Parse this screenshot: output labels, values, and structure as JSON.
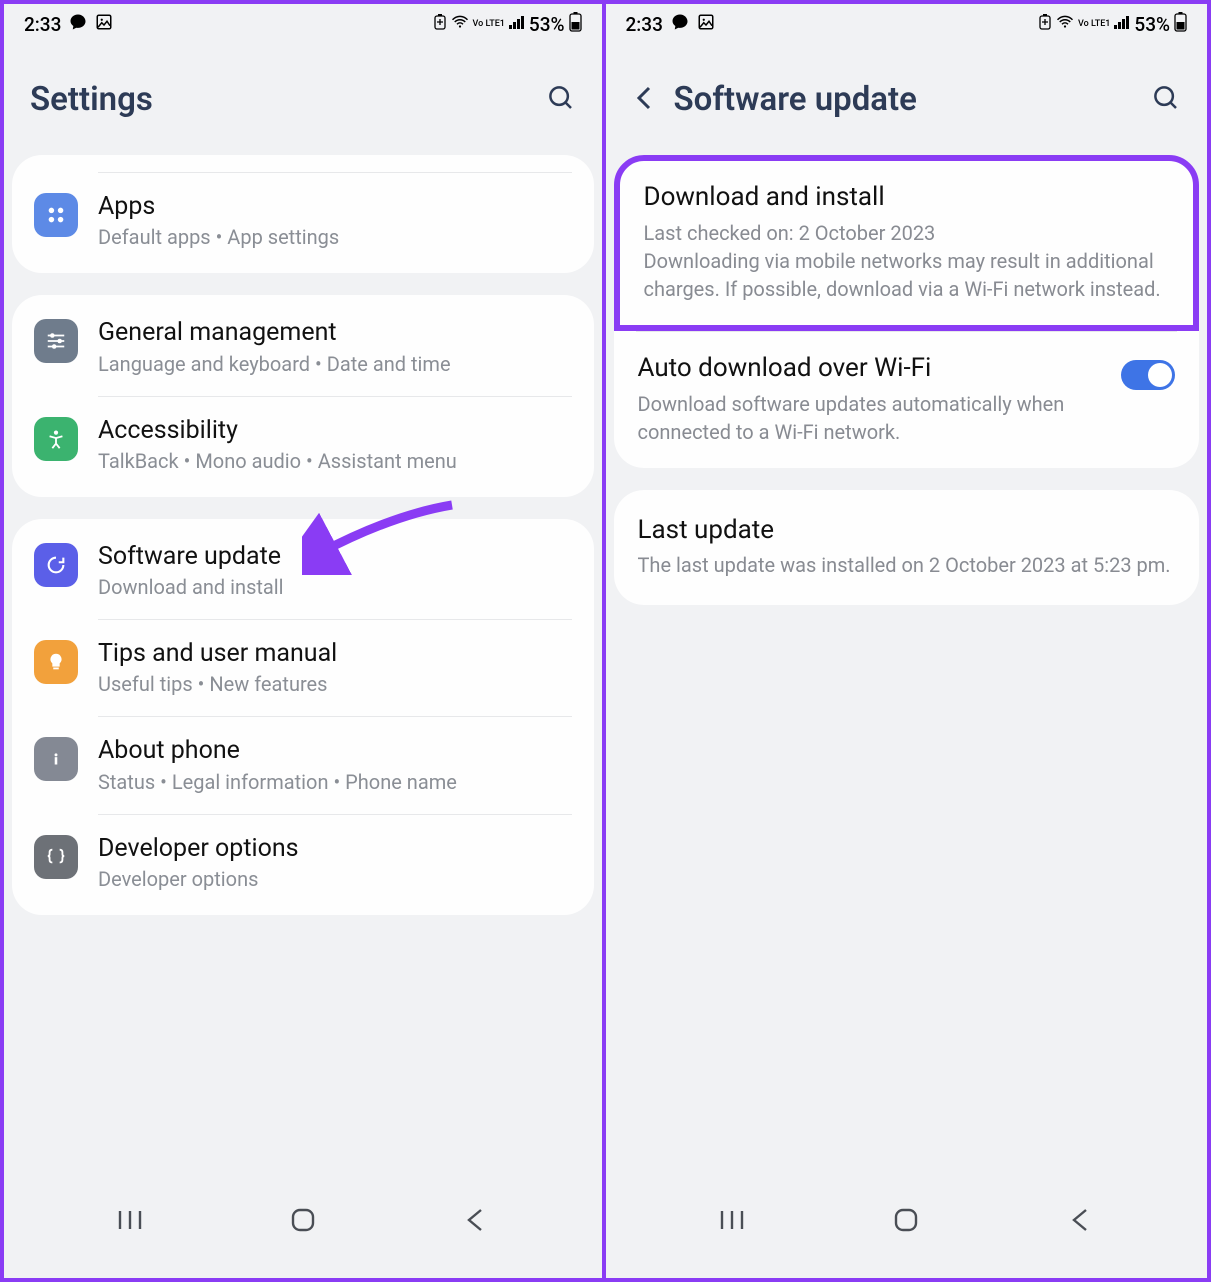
{
  "status": {
    "time": "2:33",
    "battery": "53%",
    "net_label": "Vo LTE1"
  },
  "left": {
    "header_title": "Settings",
    "apps": {
      "title": "Apps",
      "sub": "Default apps  •  App settings"
    },
    "general": {
      "title": "General management",
      "sub": "Language and keyboard  •  Date and time"
    },
    "accessibility": {
      "title": "Accessibility",
      "sub": "TalkBack  •  Mono audio  •  Assistant menu"
    },
    "software": {
      "title": "Software update",
      "sub": "Download and install"
    },
    "tips": {
      "title": "Tips and user manual",
      "sub": "Useful tips  •  New features"
    },
    "about": {
      "title": "About phone",
      "sub": "Status  •  Legal information  •  Phone name"
    },
    "dev": {
      "title": "Developer options",
      "sub": "Developer options"
    }
  },
  "right": {
    "header_title": "Software update",
    "download": {
      "title": "Download and install",
      "sub": "Last checked on: 2 October 2023\nDownloading via mobile networks may result in additional charges. If possible, download via a Wi-Fi network instead."
    },
    "auto": {
      "title": "Auto download over Wi-Fi",
      "sub": "Download software updates automatically when connected to a Wi-Fi network.",
      "enabled": true
    },
    "last": {
      "title": "Last update",
      "sub": "The last update was installed on 2 October 2023 at 5:23 pm."
    }
  }
}
